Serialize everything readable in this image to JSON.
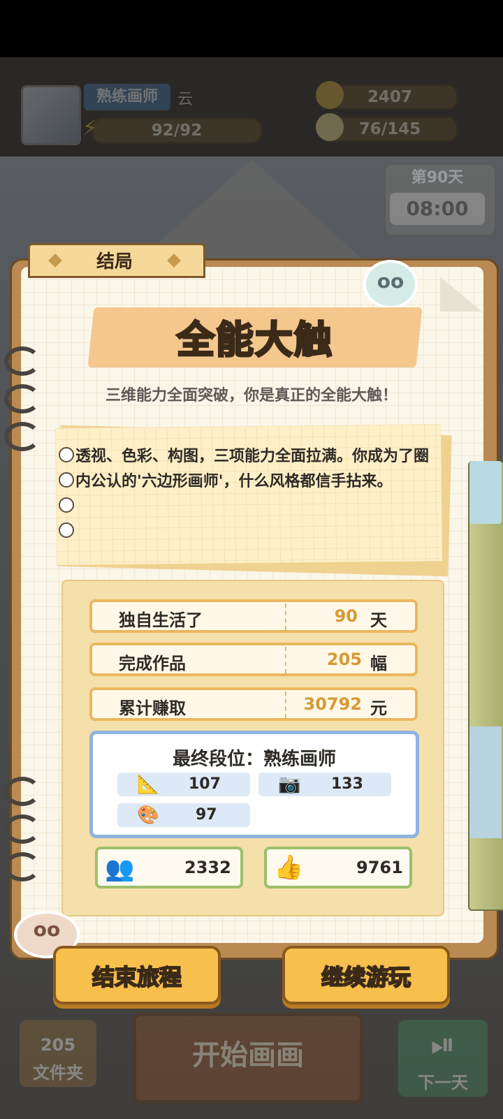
{
  "hud": {
    "rank_badge": "熟练画师",
    "player_name": "云",
    "energy": "92/92",
    "coins": "2407",
    "ideas": "76/145",
    "calendar_day": "第90天",
    "calendar_time": "08:00"
  },
  "bottom_bar": {
    "folder_count": "205",
    "folder_label": "文件夹",
    "start_draw": "开始画画",
    "next_day": "下一天"
  },
  "modal": {
    "tab_label": "结局",
    "title": "全能大触",
    "subtitle": "三维能力全面突破，你是真正的全能大触！",
    "note_text": "透视、色彩、构图，三项能力全面拉满。你成为了圈内公认的'六边形画师'，什么风格都信手拈来。",
    "stats": [
      {
        "label": "独自生活了",
        "value": "90",
        "unit": "天"
      },
      {
        "label": "完成作品",
        "value": "205",
        "unit": "幅"
      },
      {
        "label": "累计赚取",
        "value": "30792",
        "unit": "元"
      }
    ],
    "rank_label": "最终段位：熟练画师",
    "skills": [
      {
        "icon": "ruler-icon",
        "value": "107"
      },
      {
        "icon": "camera-icon",
        "value": "133"
      },
      {
        "icon": "palette-icon",
        "value": "97"
      }
    ],
    "fans": "2332",
    "likes": "9761",
    "end_button": "结束旅程",
    "continue_button": "继续游玩"
  },
  "colors": {
    "accent_yellow": "#f7c04d",
    "value_orange": "#d69a35",
    "rank_blue": "#8fb3df",
    "social_green": "#9cc06a"
  }
}
